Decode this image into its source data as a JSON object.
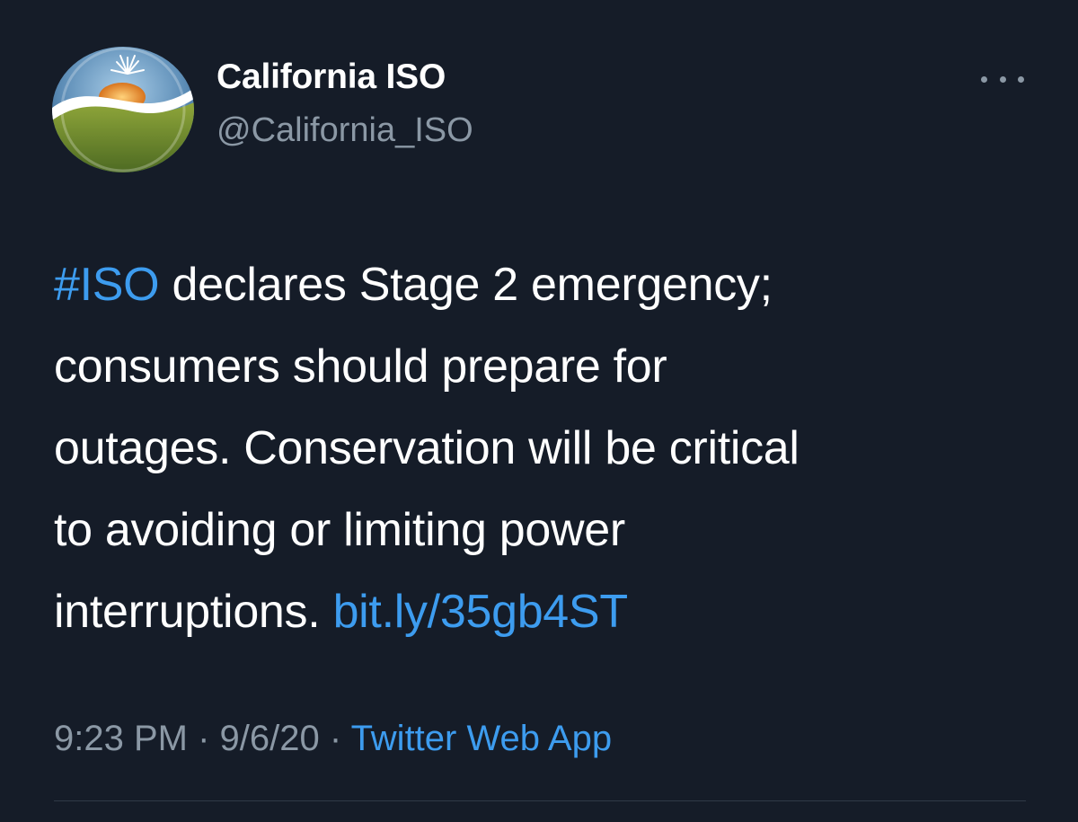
{
  "user": {
    "display_name": "California ISO",
    "handle": "@California_ISO"
  },
  "tweet": {
    "hashtag": "#ISO",
    "line1_rest": " declares Stage 2 emergency;",
    "line2": "consumers should prepare for",
    "line3": "outages. Conservation will be critical",
    "line4": "to avoiding or limiting power",
    "line5_text": "interruptions. ",
    "link": "bit.ly/35gb4ST"
  },
  "meta": {
    "time": "9:23 PM",
    "separator": " · ",
    "date": "9/6/20",
    "source": "Twitter Web App"
  },
  "colors": {
    "background": "#151c28",
    "accent": "#3d9cef",
    "secondary_text": "#8b98a5"
  },
  "icons": {
    "more": "more-horizontal-icon"
  }
}
